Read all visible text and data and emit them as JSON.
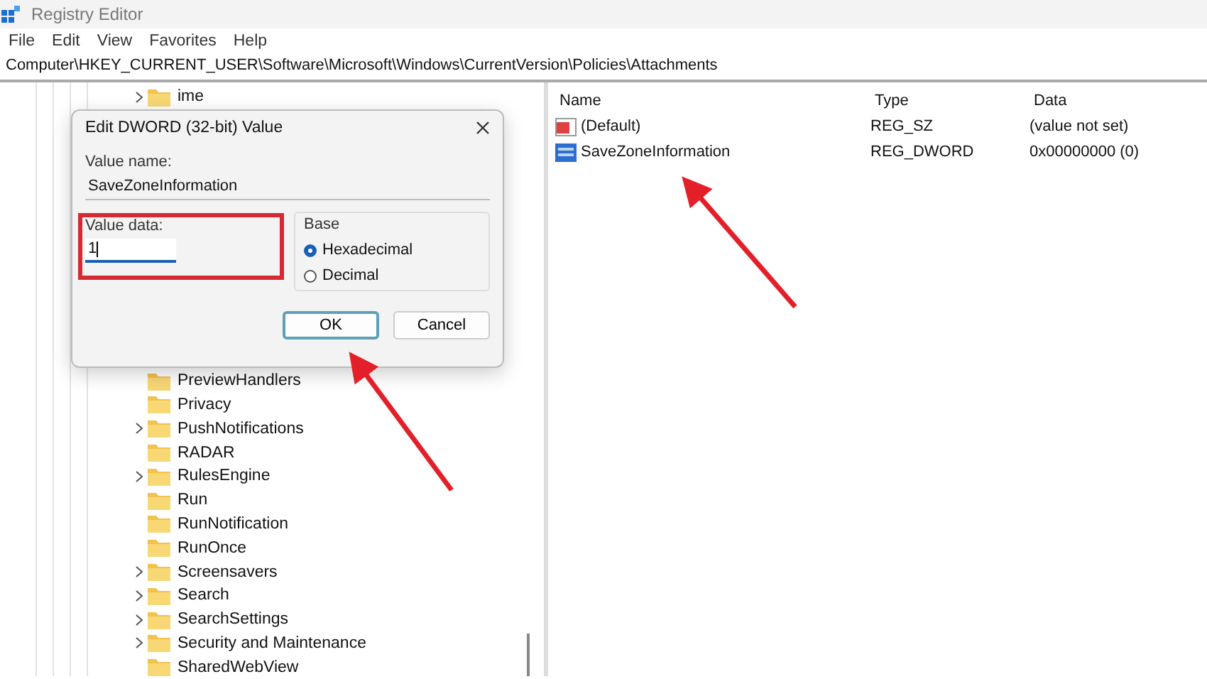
{
  "window": {
    "title": "Registry Editor"
  },
  "menu": [
    "File",
    "Edit",
    "View",
    "Favorites",
    "Help"
  ],
  "address": "Computer\\HKEY_CURRENT_USER\\Software\\Microsoft\\Windows\\CurrentVersion\\Policies\\Attachments",
  "tree": {
    "items": [
      {
        "label": "ime",
        "has_children": true
      },
      {
        "label": "PreviewHandlers",
        "has_children": false
      },
      {
        "label": "Privacy",
        "has_children": false
      },
      {
        "label": "PushNotifications",
        "has_children": true
      },
      {
        "label": "RADAR",
        "has_children": false
      },
      {
        "label": "RulesEngine",
        "has_children": true
      },
      {
        "label": "Run",
        "has_children": false
      },
      {
        "label": "RunNotification",
        "has_children": false
      },
      {
        "label": "RunOnce",
        "has_children": false
      },
      {
        "label": "Screensavers",
        "has_children": true
      },
      {
        "label": "Search",
        "has_children": true
      },
      {
        "label": "SearchSettings",
        "has_children": true
      },
      {
        "label": "Security and Maintenance",
        "has_children": true
      },
      {
        "label": "SharedWebView",
        "has_children": false
      }
    ]
  },
  "list": {
    "columns": [
      "Name",
      "Type",
      "Data"
    ],
    "rows": [
      {
        "kind": "string",
        "name": "(Default)",
        "type": "REG_SZ",
        "data": "(value not set)"
      },
      {
        "kind": "binary",
        "name": "SaveZoneInformation",
        "type": "REG_DWORD",
        "data": "0x00000000 (0)"
      }
    ]
  },
  "dialog": {
    "title": "Edit DWORD (32-bit) Value",
    "value_name_label": "Value name:",
    "value_name": "SaveZoneInformation",
    "value_data_label": "Value data:",
    "value_data": "1",
    "base_label": "Base",
    "base_options": [
      {
        "label": "Hexadecimal",
        "selected": true
      },
      {
        "label": "Decimal",
        "selected": false
      }
    ],
    "buttons": [
      {
        "label": "OK",
        "default": true
      },
      {
        "label": "Cancel",
        "default": false
      }
    ]
  }
}
